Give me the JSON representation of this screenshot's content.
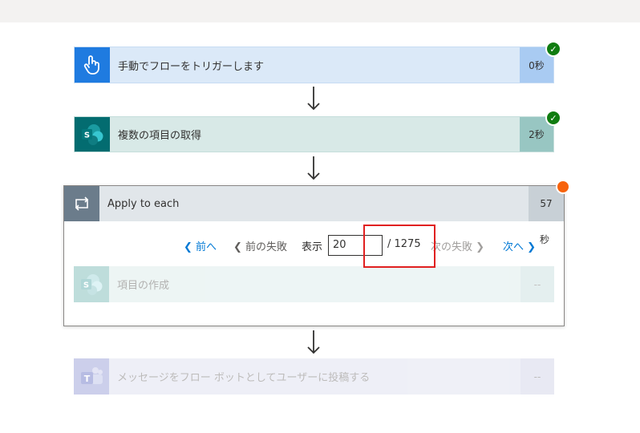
{
  "steps": {
    "trigger": {
      "title": "手動でフローをトリガーします",
      "duration": "0秒",
      "status": "succeeded"
    },
    "get_items": {
      "title": "複数の項目の取得",
      "duration": "2秒",
      "status": "succeeded"
    },
    "apply_each": {
      "title": "Apply to each",
      "duration": "57",
      "duration_suffix": "秒",
      "status": "running"
    },
    "create_item": {
      "title": "項目の作成",
      "duration": "--"
    },
    "post_teams": {
      "title": "メッセージをフロー ボットとしてユーザーに投稿する",
      "duration": "--"
    }
  },
  "pager": {
    "prev": "前へ",
    "prev_failed": "前の失敗",
    "show_label": "表示",
    "current": "20",
    "total": "/ 1275",
    "next_failed": "次の失敗",
    "next": "次へ"
  },
  "icons": {
    "trigger": "touch-hand-icon",
    "get_items": "sharepoint-icon",
    "apply_each": "loop-icon",
    "create_item": "sharepoint-icon",
    "post_teams": "teams-icon"
  },
  "colors": {
    "trigger_accent": "#0078d4",
    "sharepoint_accent": "#036c70",
    "loop_accent": "#6b7c8b",
    "success": "#107c10",
    "running": "#f7630c",
    "link": "#0078d4",
    "highlight": "#e02020"
  }
}
